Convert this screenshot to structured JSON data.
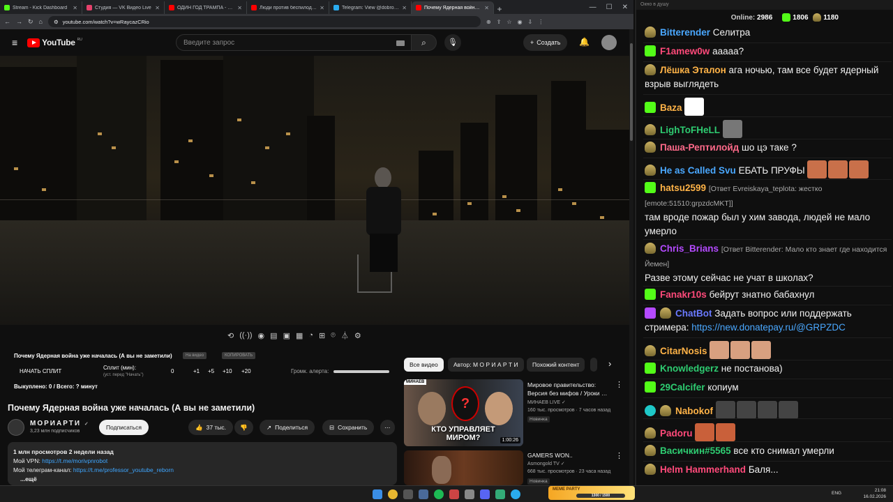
{
  "browser": {
    "tabs": [
      {
        "title": "Stream - Kick Dashboard",
        "color": "#53fc18"
      },
      {
        "title": "Студия — VK Видео Live",
        "color": "#e5416b"
      },
      {
        "title": "ОДИН ГОД ТРАМПА - YouTube",
        "color": "#ff0000"
      },
      {
        "title": "Люди против беспилодии: сем…",
        "color": "#ff0000"
      },
      {
        "title": "Telegram: View @dobro_2ch",
        "color": "#2aabee"
      },
      {
        "title": "Почему Ядерная война у…",
        "color": "#ff0000",
        "active": true
      }
    ],
    "url": "youtube.com/watch?v=wRaycazCRio"
  },
  "youtube": {
    "logo": "YouTube",
    "region": "RU",
    "search_placeholder": "Введите запрос",
    "create_label": "Создать"
  },
  "overlay": {
    "video_title": "Почему Ядерная война уже началась (А вы не заметили)",
    "tag1": "На видео",
    "tag2": "КОПИРОВАТЬ",
    "split_btn": "НАЧАТЬ СПЛИТ",
    "split_label": "Сплит (мин):",
    "split_hint": "(уст. перед \"Начать\")",
    "split_value": "0",
    "inc1": "+1",
    "inc2": "+5",
    "inc3": "+10",
    "inc4": "+20",
    "volume_label": "Громк. алерта:",
    "bought": "Выкуплено: 0 / Всего: ? минут"
  },
  "video": {
    "title": "Почему Ядерная война уже началась (А вы не заметили)",
    "channel": "МОРИАРТИ",
    "verified": "✓",
    "subscribers": "3,23 млн подписчиков",
    "subscribe": "Подписаться",
    "likes": "37 тыс.",
    "share": "Поделиться",
    "save": "Сохранить",
    "desc_meta": "1 млн просмотров  2 недели назад",
    "desc_vpn_label": "Мой VPN: ",
    "desc_vpn_link": "https://t.me/morivpnrobot",
    "desc_tg_label": "Мой телеграм-канал: ",
    "desc_tg_link": "https://t.me/professor_youtube_reborn",
    "desc_more": "...ещё"
  },
  "chips": [
    "Все видео",
    "Автор: М О Р И А Р Т И",
    "Похожий контент"
  ],
  "recommendations": [
    {
      "title": "Мировое правительство: Версия без мифов / Уроки …",
      "channel": "МИНАЕВ LIVE",
      "meta": "160 тыс. просмотров · 7 часов назад",
      "badge": "Новинка",
      "duration": "1:00:26",
      "thumb_text": "КТО УПРАВЛЯЕТ МИРОМ?",
      "thumb_tag": "МИНАЕВ"
    },
    {
      "title": "GAMERS WON..",
      "channel": "Asmongold TV",
      "meta": "668 тыс. просмотров · 23 часа назад",
      "badge": "Новинка"
    }
  ],
  "chat": {
    "window_title": "Окно в душу",
    "online_label": "Online:",
    "online": "2986",
    "kick_count": "1806",
    "other_count": "1180",
    "messages": [
      {
        "nick": "Bitterender",
        "color": "#4aa8ff",
        "src": "h",
        "text": "Селитра"
      },
      {
        "nick": "F1amew0w",
        "color": "#ff4a7a",
        "src": "k",
        "text": "ааааа?"
      },
      {
        "nick": "Лёшка Эталон",
        "color": "#ffb347",
        "src": "h",
        "text": "ага ночью, там все будет ядерный взрыв выглядеть"
      },
      {
        "nick": "Baza",
        "color": "#ffb347",
        "src": "k",
        "text": ""
      },
      {
        "nick": "LighToFHeLL",
        "color": "#2ecc71",
        "src": "h",
        "text": ""
      },
      {
        "nick": "Паша-Рептилойд",
        "color": "#ff6a8a",
        "src": "h",
        "text": "шо цэ таке ?"
      },
      {
        "nick": "He as Called Svu",
        "color": "#4aa8ff",
        "src": "h",
        "text": "ЕБАТЬ ПРУФЫ"
      },
      {
        "nick": "hatsu2599",
        "color": "#ffb347",
        "src": "k",
        "reply": "[Ответ Evreiskaya_teplota: жестко [emote:51510:grpzdcMKT]]",
        "text": "там вроде пожар был у хим завода, людей не мало умерло"
      },
      {
        "nick": "Chris_Brians",
        "color": "#b44aff",
        "src": "h",
        "reply": "[Ответ Bitterender: Мало кто знает где находится Йемен]",
        "text": "Разве этому сейчас не учат в школах?"
      },
      {
        "nick": "Fanakr10s",
        "color": "#ff4a7a",
        "src": "k",
        "text": "бейрут знатно бабахнул"
      },
      {
        "nick": "ChatBot",
        "color": "#6a7aff",
        "src": "h",
        "text": "Задать вопрос или поддержать стримера: ",
        "link": "https://new.donatepay.ru/@GRPZDC"
      },
      {
        "nick": "CitarNosis",
        "color": "#ffb347",
        "src": "h",
        "text": ""
      },
      {
        "nick": "Knowledgerz",
        "color": "#2ecc71",
        "src": "k",
        "text": "не постанова)"
      },
      {
        "nick": "29Calcifer",
        "color": "#2ecc71",
        "src": "k",
        "text": "копиум"
      },
      {
        "nick": "Nabokof",
        "color": "#ffb347",
        "src": "h",
        "text": ""
      },
      {
        "nick": "Padoru",
        "color": "#ff4a7a",
        "src": "h",
        "text": ""
      },
      {
        "nick": "Васичкин#5565",
        "color": "#2ecc71",
        "src": "h",
        "text": "все кто снимал умерли"
      },
      {
        "nick": "Helm Hammerhand",
        "color": "#ff4a7a",
        "src": "h",
        "text": "Баля..."
      }
    ]
  },
  "taskbar": {
    "lang": "ENG",
    "time": "21:08",
    "date": "16.02.2026",
    "meme_label": "MEME PARTY",
    "meme_progress": "1300 / 1500"
  }
}
